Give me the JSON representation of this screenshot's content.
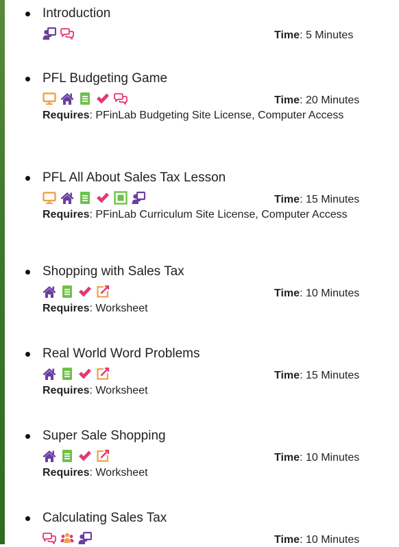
{
  "colors": {
    "purple": "#6a3fa0",
    "orange": "#f0a14a",
    "green": "#6cc24a",
    "pink": "#e8366f",
    "edge": "#3f7a2a"
  },
  "time_label": "Time",
  "requires_label": "Requires",
  "items": [
    {
      "title": "Introduction",
      "icons": [
        "presenter-icon",
        "speech-bubbles-icon"
      ],
      "time": "5 Minutes",
      "requires": ""
    },
    {
      "title": "PFL Budgeting Game",
      "icons": [
        "monitor-icon",
        "home-icon",
        "book-icon",
        "checkmark-icon",
        "speech-bubbles-icon"
      ],
      "time": "20 Minutes",
      "requires": "PFinLab Budgeting Site License, Computer Access"
    },
    {
      "title": "PFL All About Sales Tax Lesson",
      "icons": [
        "monitor-icon",
        "home-icon",
        "book-icon",
        "checkmark-icon",
        "expand-icon",
        "presenter-icon"
      ],
      "time": "15 Minutes",
      "requires": "PFinLab Curriculum Site License, Computer Access"
    },
    {
      "title": "Shopping with Sales Tax",
      "icons": [
        "home-icon",
        "book-icon",
        "checkmark-icon",
        "edit-icon"
      ],
      "time": "10 Minutes",
      "requires": "Worksheet"
    },
    {
      "title": "Real World Word Problems",
      "icons": [
        "home-icon",
        "book-icon",
        "checkmark-icon",
        "edit-icon"
      ],
      "time": "15 Minutes",
      "requires": "Worksheet"
    },
    {
      "title": "Super Sale Shopping",
      "icons": [
        "home-icon",
        "book-icon",
        "checkmark-icon",
        "edit-icon"
      ],
      "time": "10 Minutes",
      "requires": "Worksheet"
    },
    {
      "title": "Calculating Sales Tax",
      "icons": [
        "speech-bubbles-icon",
        "group-icon",
        "presenter-icon"
      ],
      "time": "10 Minutes",
      "requires": ""
    }
  ]
}
